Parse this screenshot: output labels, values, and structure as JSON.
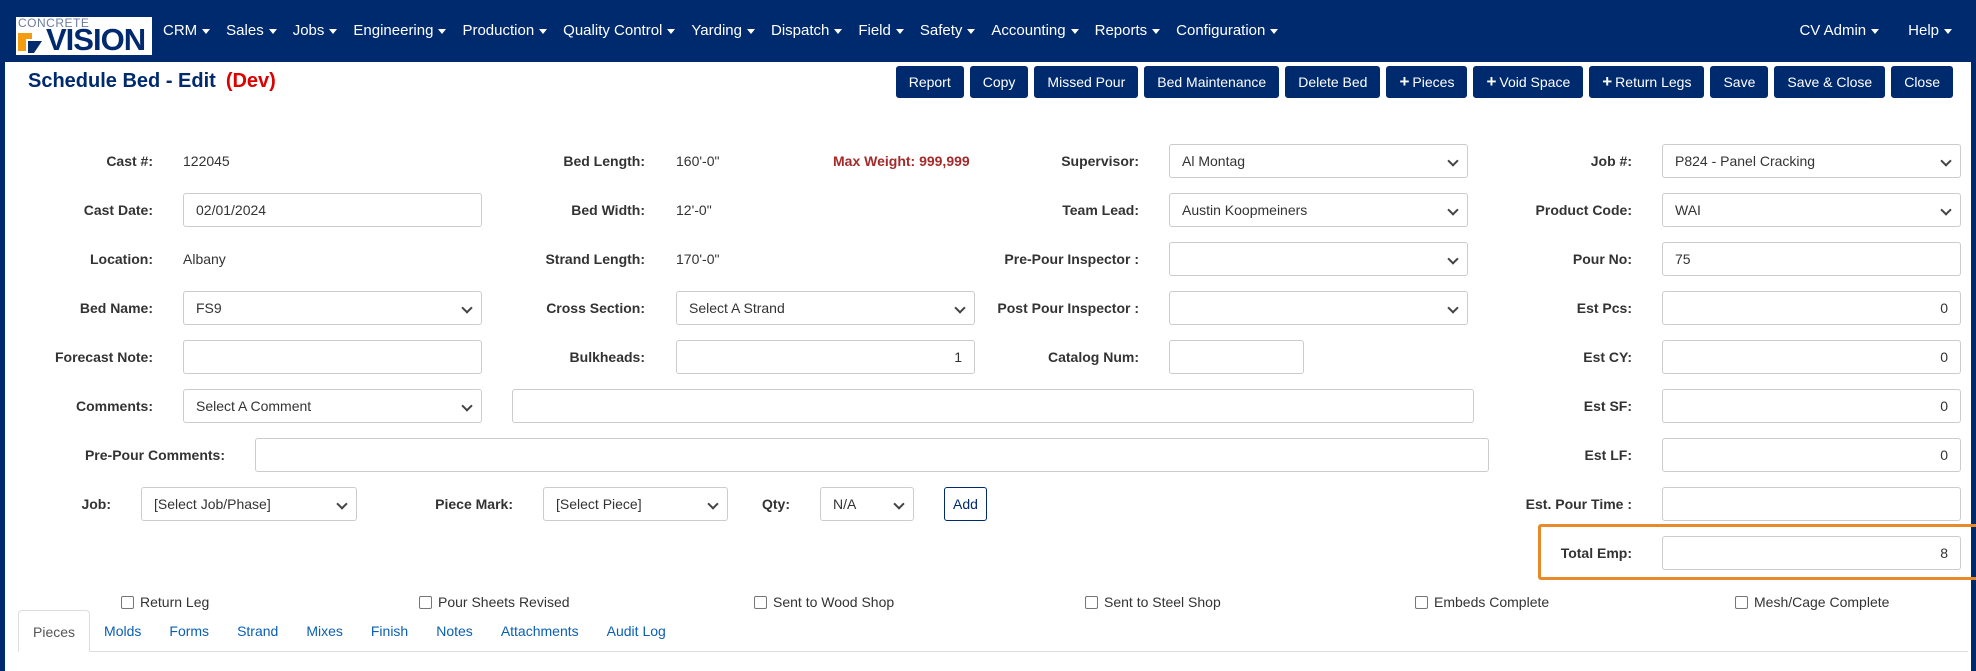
{
  "logo": {
    "small": "CONCRETE",
    "big": "VISION"
  },
  "nav": {
    "items": [
      "CRM",
      "Sales",
      "Jobs",
      "Engineering",
      "Production",
      "Quality Control",
      "Yarding",
      "Dispatch",
      "Field",
      "Safety",
      "Accounting",
      "Reports",
      "Configuration"
    ],
    "user": "CV Admin",
    "help": "Help"
  },
  "page": {
    "title": "Schedule Bed - Edit",
    "env": "(Dev)"
  },
  "toolbar": {
    "report": "Report",
    "copy": "Copy",
    "missed_pour": "Missed Pour",
    "bed_maintenance": "Bed Maintenance",
    "delete_bed": "Delete Bed",
    "pieces": "Pieces",
    "void_space": "Void Space",
    "return_legs": "Return Legs",
    "save": "Save",
    "save_close": "Save & Close",
    "close": "Close"
  },
  "form": {
    "cast_no": {
      "label": "Cast #:",
      "value": "122045"
    },
    "cast_date": {
      "label": "Cast Date:",
      "value": "02/01/2024"
    },
    "location": {
      "label": "Location:",
      "value": "Albany"
    },
    "bed_name": {
      "label": "Bed Name:",
      "value": "FS9"
    },
    "forecast_note": {
      "label": "Forecast Note:",
      "value": ""
    },
    "comments": {
      "label": "Comments:",
      "value": "Select A Comment",
      "text": ""
    },
    "pre_pour_comments": {
      "label": "Pre-Pour Comments:",
      "value": ""
    },
    "job": {
      "label": "Job:",
      "value": "[Select Job/Phase]"
    },
    "piece_mark": {
      "label": "Piece Mark:",
      "value": "[Select Piece]"
    },
    "qty": {
      "label": "Qty:",
      "value": "N/A"
    },
    "add": "Add",
    "bed_length": {
      "label": "Bed Length:",
      "value": "160'-0\""
    },
    "bed_width": {
      "label": "Bed Width:",
      "value": "12'-0\""
    },
    "strand_length": {
      "label": "Strand Length:",
      "value": "170'-0\""
    },
    "cross_section": {
      "label": "Cross Section:",
      "value": "Select A Strand"
    },
    "bulkheads": {
      "label": "Bulkheads:",
      "value": "1"
    },
    "max_weight": "Max Weight: 999,999",
    "supervisor": {
      "label": "Supervisor:",
      "value": "Al Montag"
    },
    "team_lead": {
      "label": "Team Lead:",
      "value": "Austin Koopmeiners"
    },
    "pre_pour_inspector": {
      "label": "Pre-Pour Inspector :",
      "value": ""
    },
    "post_pour_inspector": {
      "label": "Post Pour Inspector :",
      "value": ""
    },
    "catalog_num": {
      "label": "Catalog Num:",
      "value": ""
    },
    "job_no": {
      "label": "Job #:",
      "value": "P824 - Panel Cracking"
    },
    "product_code": {
      "label": "Product Code:",
      "value": "WAI"
    },
    "pour_no": {
      "label": "Pour No:",
      "value": "75"
    },
    "est_pcs": {
      "label": "Est Pcs:",
      "value": "0"
    },
    "est_cy": {
      "label": "Est CY:",
      "value": "0"
    },
    "est_sf": {
      "label": "Est SF:",
      "value": "0"
    },
    "est_lf": {
      "label": "Est LF:",
      "value": "0"
    },
    "est_pour_time": {
      "label": "Est. Pour Time :",
      "value": ""
    },
    "total_emp": {
      "label": "Total Emp:",
      "value": "8"
    }
  },
  "checkboxes": [
    "Return Leg",
    "Pour Sheets Revised",
    "Sent to Wood Shop",
    "Sent to Steel Shop",
    "Embeds Complete",
    "Mesh/Cage Complete"
  ],
  "tabs": [
    "Pieces",
    "Molds",
    "Forms",
    "Strand",
    "Mixes",
    "Finish",
    "Notes",
    "Attachments",
    "Audit Log"
  ],
  "colors": {
    "navbar": "#002a6e",
    "dev": "#dd0000",
    "max_weight": "#a52a2a",
    "highlight": "#e8892c",
    "tab_link": "#0a5fb4"
  }
}
